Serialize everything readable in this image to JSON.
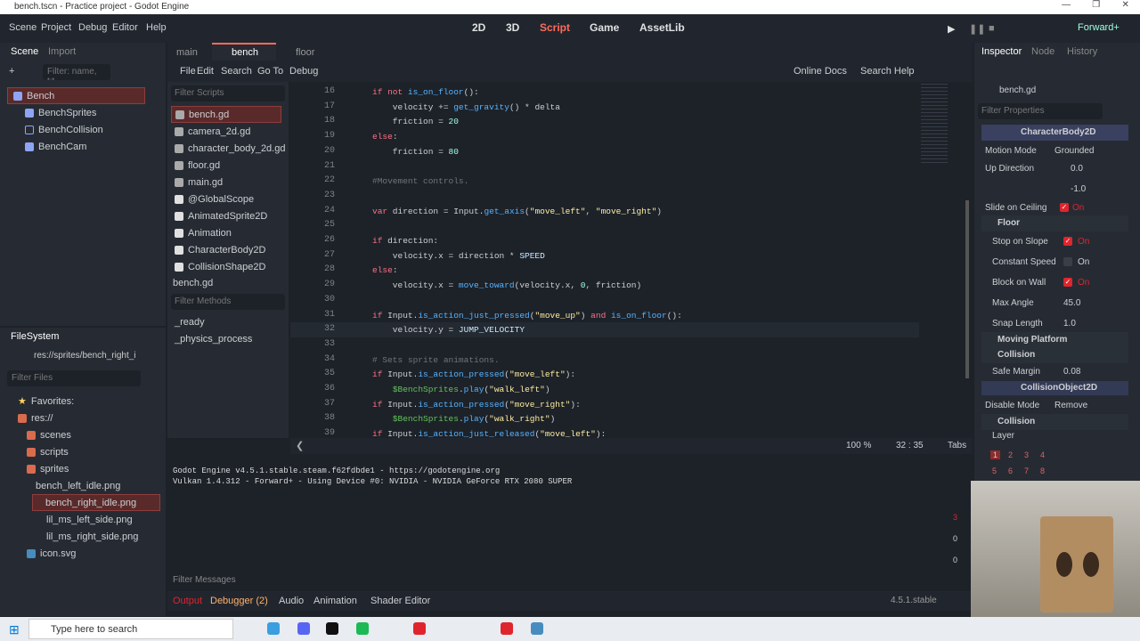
{
  "window": {
    "title": "bench.tscn - Practice project - Godot Engine"
  },
  "menu": [
    "Scene",
    "Project",
    "Debug",
    "Editor",
    "Help"
  ],
  "workspaces": [
    "2D",
    "3D",
    "Script",
    "Game",
    "AssetLib"
  ],
  "renderer": "Forward+",
  "scene_dock": {
    "tabs": [
      "Scene",
      "Import"
    ],
    "filter_placeholder": "Filter: name, t:t",
    "nodes": [
      "Bench",
      "BenchSprites",
      "BenchCollision",
      "BenchCam"
    ]
  },
  "filesystem": {
    "title": "FileSystem",
    "path": "res://sprites/bench_right_i",
    "filter_placeholder": "Filter Files",
    "items": [
      "Favorites:",
      "res://",
      "scenes",
      "scripts",
      "sprites",
      "bench_left_idle.png",
      "bench_right_idle.png",
      "lil_ms_left_side.png",
      "lil_ms_right_side.png",
      "icon.svg"
    ]
  },
  "script_tabs": [
    "main",
    "bench",
    "floor"
  ],
  "script_menu": [
    "File",
    "Edit",
    "Search",
    "Go To",
    "Debug"
  ],
  "script_toolbar": {
    "online_docs": "Online Docs",
    "search_help": "Search Help"
  },
  "scripts_panel": {
    "filter_placeholder": "Filter Scripts",
    "scripts": [
      "bench.gd",
      "camera_2d.gd",
      "character_body_2d.gd",
      "floor.gd",
      "main.gd",
      "@GlobalScope",
      "AnimatedSprite2D",
      "Animation",
      "CharacterBody2D",
      "CollisionShape2D"
    ],
    "current": "bench.gd",
    "methods_placeholder": "Filter Methods",
    "methods": [
      "_ready",
      "_physics_process"
    ]
  },
  "code": {
    "lines": [
      {
        "n": "16",
        "t": "if not is_on_floor():"
      },
      {
        "n": "17",
        "t": "    velocity += get_gravity() * delta"
      },
      {
        "n": "18",
        "t": "    friction = 20"
      },
      {
        "n": "19",
        "t": "else:"
      },
      {
        "n": "20",
        "t": "    friction = 80"
      },
      {
        "n": "21",
        "t": ""
      },
      {
        "n": "22",
        "t": "#Movement controls."
      },
      {
        "n": "23",
        "t": ""
      },
      {
        "n": "24",
        "t": "var direction = Input.get_axis(\"move_left\", \"move_right\")"
      },
      {
        "n": "25",
        "t": ""
      },
      {
        "n": "26",
        "t": "if direction:"
      },
      {
        "n": "27",
        "t": "    velocity.x = direction * SPEED"
      },
      {
        "n": "28",
        "t": "else:"
      },
      {
        "n": "29",
        "t": "    velocity.x = move_toward(velocity.x, 0, friction)"
      },
      {
        "n": "30",
        "t": ""
      },
      {
        "n": "31",
        "t": "if Input.is_action_just_pressed(\"move_up\") and is_on_floor():"
      },
      {
        "n": "32",
        "t": "    velocity.y = JUMP_VELOCITY"
      },
      {
        "n": "33",
        "t": ""
      },
      {
        "n": "34",
        "t": "# Sets sprite animations."
      },
      {
        "n": "35",
        "t": "if Input.is_action_pressed(\"move_left\"):"
      },
      {
        "n": "36",
        "t": "    $BenchSprites.play(\"walk_left\")"
      },
      {
        "n": "37",
        "t": "if Input.is_action_pressed(\"move_right\"):"
      },
      {
        "n": "38",
        "t": "    $BenchSprites.play(\"walk_right\")"
      },
      {
        "n": "39",
        "t": "if Input.is_action_just_released(\"move_left\"):"
      }
    ],
    "zoom": "100 %",
    "cursor": "32 :  35",
    "indent": "Tabs"
  },
  "output": {
    "lines": [
      "Godot Engine v4.5.1.stable.steam.f62fdbde1 - https://godotengine.org",
      "Vulkan 1.4.312 - Forward+ - Using Device #0: NVIDIA - NVIDIA GeForce RTX 2080 SUPER"
    ],
    "filter_placeholder": "Filter Messages",
    "counts": [
      "3",
      "0",
      "0"
    ]
  },
  "bottom_tabs": [
    "Output",
    "Debugger (2)",
    "Audio",
    "Animation",
    "Shader Editor"
  ],
  "version": "4.5.1.stable",
  "inspector": {
    "tabs": [
      "Inspector",
      "Node",
      "History"
    ],
    "resource": "bench.gd",
    "filter_placeholder": "Filter Properties",
    "class": "CharacterBody2D",
    "motion_mode_label": "Motion Mode",
    "motion_mode": "Grounded",
    "up_direction_label": "Up Direction",
    "up_x": "0.0",
    "up_y": "-1.0",
    "slide_on_ceiling": "Slide on Ceiling",
    "floor": "Floor",
    "stop_on_slope": "Stop on Slope",
    "constant_speed": "Constant Speed",
    "block_on_wall": "Block on Wall",
    "max_angle": "Max Angle",
    "max_angle_val": "45.0",
    "snap_length": "Snap Length",
    "snap_length_val": "1.0",
    "on_label": "On",
    "moving_platform": "Moving Platform",
    "collision": "Collision",
    "safe_margin": "Safe Margin",
    "safe_margin_val": "0.08",
    "collision_object": "CollisionObject2D",
    "disable_mode": "Disable Mode",
    "disable_mode_val": "Remove",
    "collision2": "Collision",
    "layer": "Layer",
    "layers": [
      "1",
      "2",
      "3",
      "4",
      "5",
      "6",
      "7",
      "8"
    ]
  },
  "taskbar": {
    "search_placeholder": "Type here to search"
  }
}
